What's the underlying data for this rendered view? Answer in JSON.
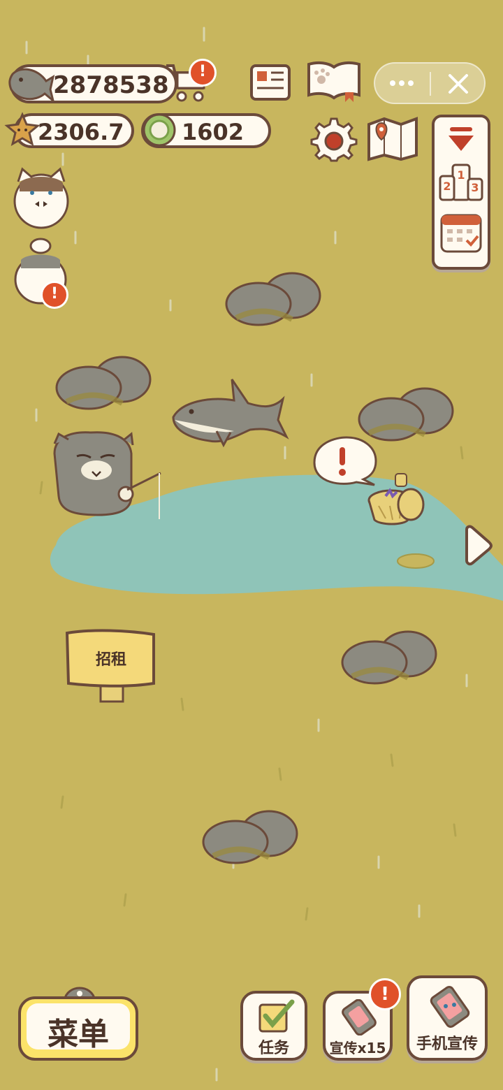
{
  "currency": {
    "fish": "2878538",
    "stars": "2306.7",
    "gems": "1602"
  },
  "capsule": {
    "more_icon": "more-dots-icon",
    "close_icon": "close-x-icon"
  },
  "sign": {
    "text": "招租"
  },
  "bottom": {
    "menu_label": "菜单",
    "tasks_label": "任务",
    "promo_label": "宣传x15",
    "phone_promo_label": "手机宣传"
  },
  "badges": {
    "alert": "!"
  },
  "colors": {
    "ground": "#c8b65e",
    "pond": "#8fc4b8",
    "outline": "#6b4a3a",
    "alert": "#e0512a",
    "panel": "#fffaf0"
  }
}
